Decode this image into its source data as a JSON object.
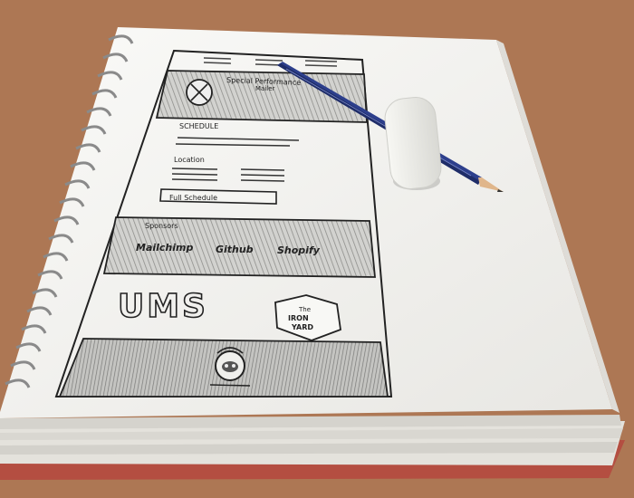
{
  "sketch": {
    "header_label": "Special Performance",
    "header_sub": "Mailer",
    "schedule_label": "SCHEDULE",
    "location_label": "Location",
    "button_label": "Full Schedule",
    "sponsors_label": "Sponsors",
    "sponsors": [
      "Mailchimp",
      "Github",
      "Shopify"
    ],
    "logo_ums": "UMS",
    "logo_ironyard_line1": "The",
    "logo_ironyard_line2": "IRON",
    "logo_ironyard_line3": "YARD"
  },
  "colors": {
    "table": "#b57c58",
    "paper": "#f3f2ef",
    "pencil_body": "#2d3f8c",
    "eraser": "#ebebe6",
    "ink": "#222222"
  }
}
